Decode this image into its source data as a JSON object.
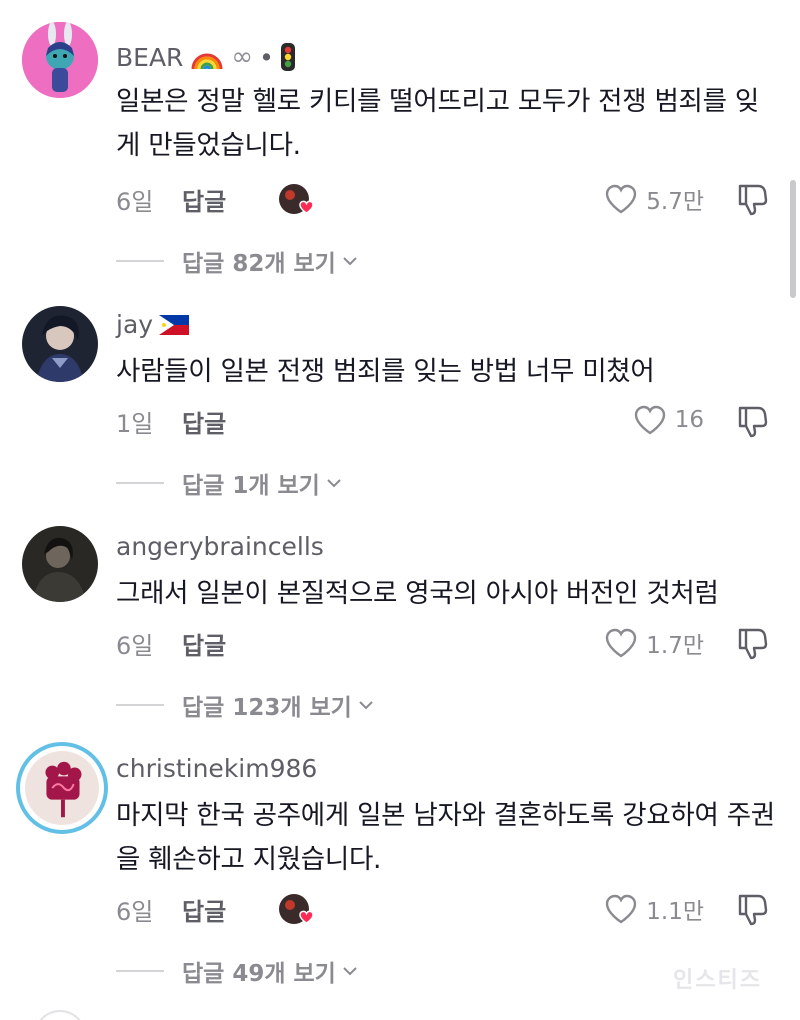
{
  "comments": [
    {
      "username": "BEAR",
      "user_emojis": [
        "rainbow",
        "∞",
        "•",
        "traffic-light"
      ],
      "text": "일본은 정말 헬로 키티를 떨어뜨리고 모두가 전쟁 범죄를 잊게 만들었습니다.",
      "date": "6일",
      "reply_label": "답글",
      "creator_liked": true,
      "likes": "5.7만",
      "view_replies": "답글 82개 보기"
    },
    {
      "username": "jay",
      "user_emojis": [
        "philippines-flag"
      ],
      "text": "사람들이 일본 전쟁 범죄를 잊는 방법 너무 미쳤어",
      "date": "1일",
      "reply_label": "답글",
      "creator_liked": false,
      "likes": "16",
      "view_replies": "답글 1개 보기"
    },
    {
      "username": "angerybraincells",
      "user_emojis": [],
      "text": "그래서 일본이 본질적으로 영국의 아시아 버전인 것처럼",
      "date": "6일",
      "reply_label": "답글",
      "creator_liked": false,
      "likes": "1.7만",
      "view_replies": "답글 123개 보기"
    },
    {
      "username": "christinekim986",
      "user_emojis": [],
      "text": "마지막 한국 공주에게 일본 남자와 결혼하도록 강요하여 주권을 훼손하고 지웠습니다.",
      "date": "6일",
      "reply_label": "답글",
      "creator_liked": true,
      "likes": "1.1만",
      "view_replies": "답글 49개 보기"
    }
  ],
  "watermark": "인스티즈",
  "colors": {
    "text": "#161823",
    "secondary": "#8a8b91",
    "username": "#5d5e66",
    "heart_red": "#fe2c55"
  }
}
